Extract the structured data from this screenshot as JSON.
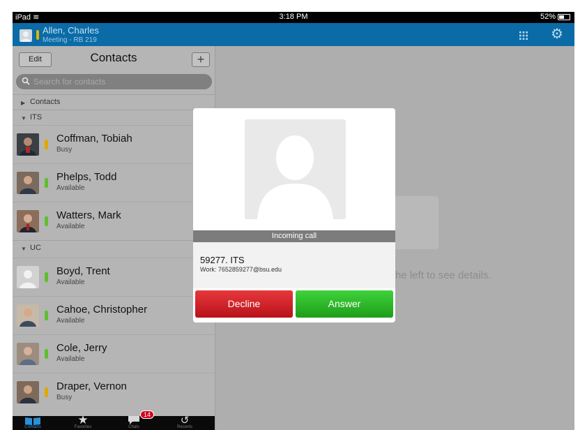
{
  "status_bar": {
    "device": "iPad",
    "time": "3:18 PM",
    "battery": "52%"
  },
  "header": {
    "user_name": "Allen, Charles",
    "user_location": "Meeting - RB 219",
    "icons": [
      "grid-icon",
      "gear-icon"
    ]
  },
  "contacts_panel": {
    "edit_label": "Edit",
    "title": "Contacts",
    "add_label": "+",
    "search_placeholder": "Search for contacts",
    "groups": [
      {
        "label": "Contacts",
        "expanded": false
      },
      {
        "label": "ITS",
        "expanded": true
      },
      {
        "label": "UC",
        "expanded": true
      }
    ],
    "contacts": [
      {
        "name": "Coffman, Tobiah",
        "status": "Busy",
        "status_color": "#e0a800",
        "group": "ITS"
      },
      {
        "name": "Phelps, Todd",
        "status": "Available",
        "status_color": "#5fbf2f",
        "group": "ITS"
      },
      {
        "name": "Watters, Mark",
        "status": "Available",
        "status_color": "#5fbf2f",
        "group": "ITS"
      },
      {
        "name": "Boyd, Trent",
        "status": "Available",
        "status_color": "#5fbf2f",
        "group": "UC"
      },
      {
        "name": "Cahoe, Christopher",
        "status": "Available",
        "status_color": "#5fbf2f",
        "group": "UC"
      },
      {
        "name": "Cole, Jerry",
        "status": "Available",
        "status_color": "#5fbf2f",
        "group": "UC"
      },
      {
        "name": "Draper, Vernon",
        "status": "Busy",
        "status_color": "#e0a800",
        "group": "UC"
      }
    ]
  },
  "tabs": [
    {
      "label": "Contacts",
      "icon": "book-icon",
      "active": true
    },
    {
      "label": "Favorites",
      "icon": "star-icon",
      "active": false
    },
    {
      "label": "Chats",
      "icon": "chat-icon",
      "active": false,
      "badge": "14"
    },
    {
      "label": "Recents",
      "icon": "history-icon",
      "active": false
    }
  ],
  "detail_hint": "he left to see details.",
  "incoming_call": {
    "status": "Incoming call",
    "caller": "59277. ITS",
    "work": "Work: 7652859277@bsu.edu",
    "decline_label": "Decline",
    "answer_label": "Answer"
  },
  "colors": {
    "header": "#0b6ba7",
    "decline": "#d42228",
    "answer": "#2fb82a",
    "accent": "#2d8fd6"
  }
}
